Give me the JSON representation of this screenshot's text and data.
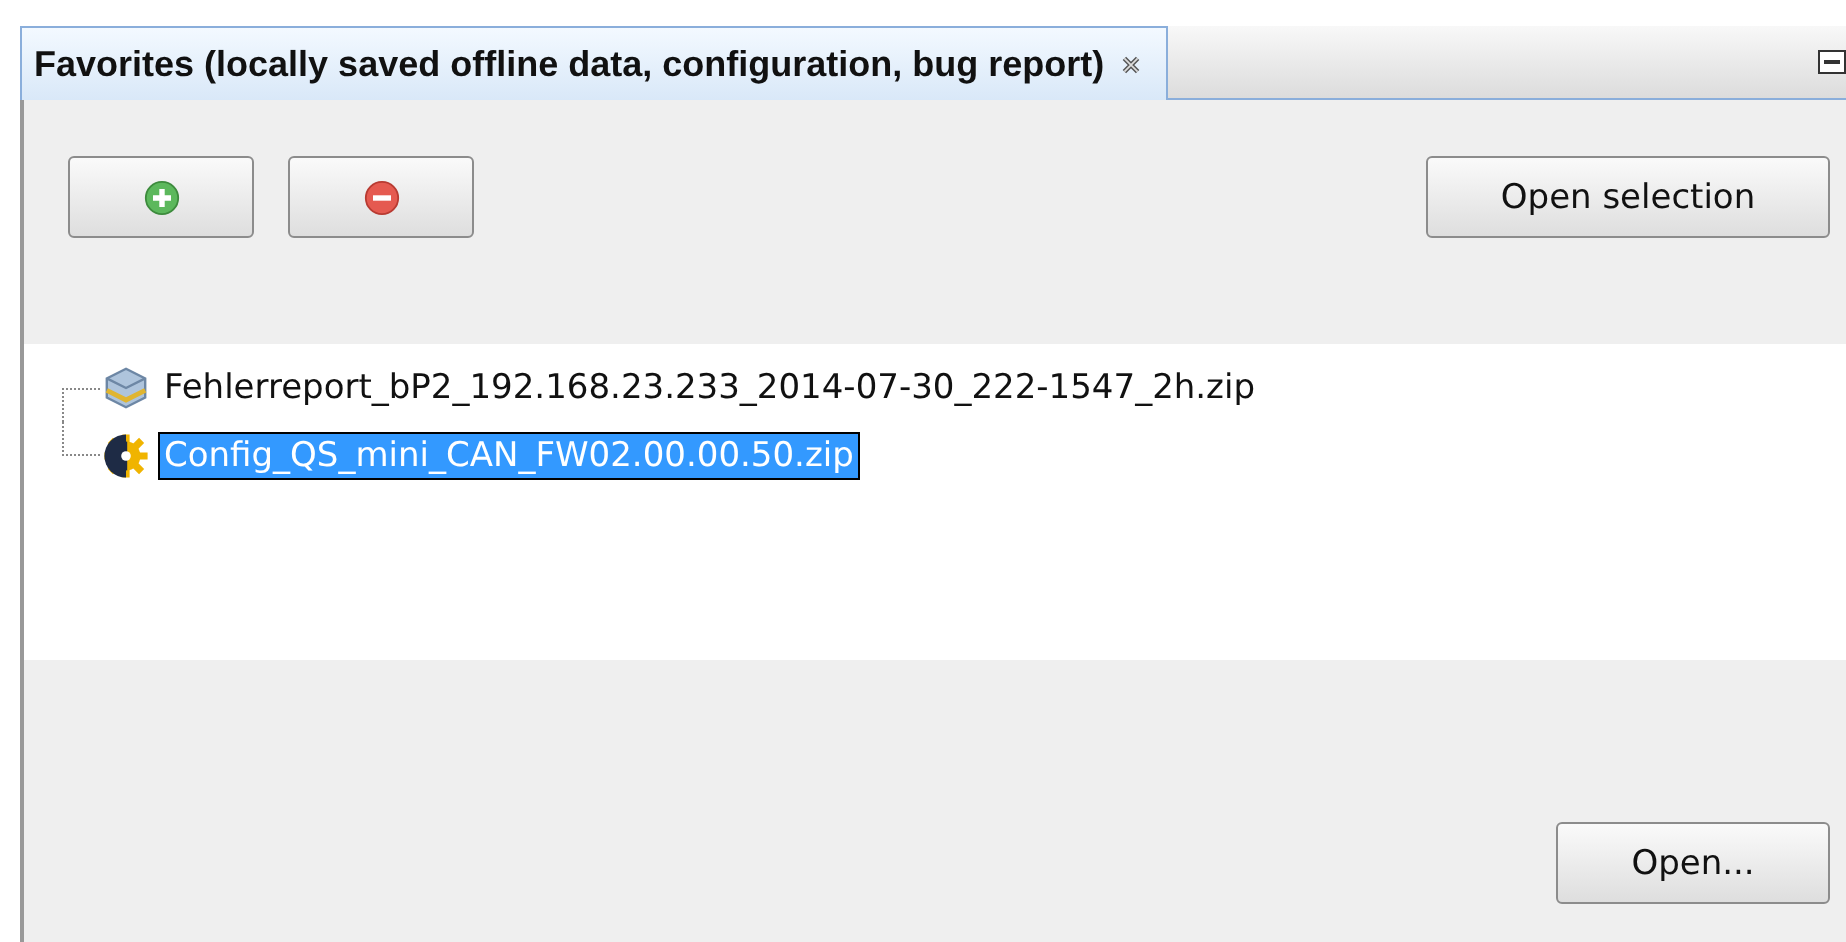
{
  "tab": {
    "title": "Favorites (locally saved offline data, configuration, bug report)",
    "selected": true
  },
  "toolbar": {
    "open_selection": "Open selection"
  },
  "tree": [
    {
      "kind": "archive",
      "label": "Fehlerreport_bP2_192.168.23.233_2014-07-30_222-1547_2h.zip",
      "selected": false
    },
    {
      "kind": "config",
      "label": "Config_QS_mini_CAN_FW02.00.00.50.zip",
      "selected": true
    }
  ],
  "footer": {
    "open": "Open..."
  }
}
